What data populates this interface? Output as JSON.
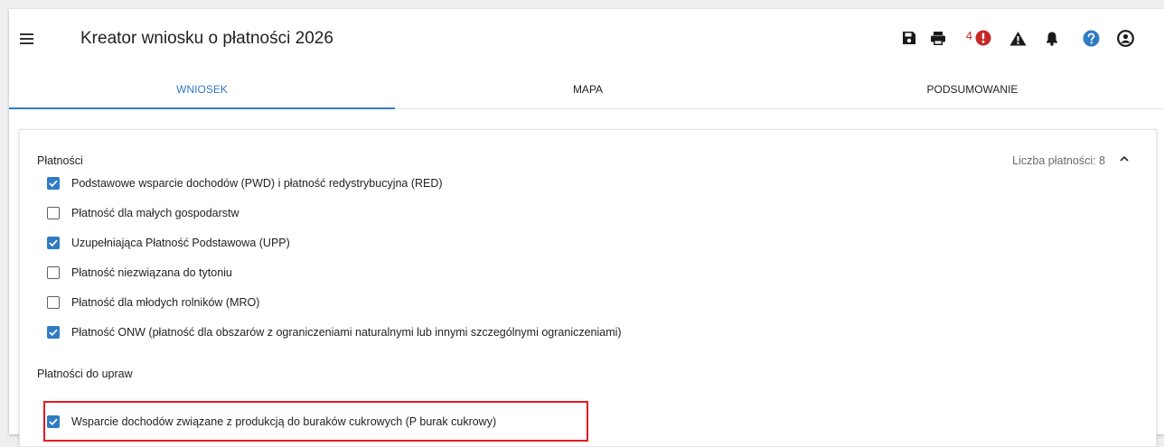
{
  "header": {
    "title": "Kreator wniosku o płatności 2026",
    "warning_count": "4"
  },
  "icons": {
    "menu": "menu-icon",
    "save": "save-icon",
    "print": "print-icon",
    "error": "error-icon",
    "warning": "warning-icon",
    "notifications": "bell-icon",
    "help": "help-icon",
    "account": "account-icon"
  },
  "colors": {
    "accent": "#2f7bc4",
    "error": "#c62828",
    "highlight": "#e31b23"
  },
  "tabs": [
    {
      "label": "WNIOSEK",
      "active": true
    },
    {
      "label": "MAPA",
      "active": false
    },
    {
      "label": "PODSUMOWANIE",
      "active": false
    }
  ],
  "payments": {
    "title": "Płatności",
    "count_label": "Liczba płatności: 8",
    "items": [
      {
        "label": "Podstawowe wsparcie dochodów (PWD) i płatność redystrybucyjna (RED)",
        "checked": true
      },
      {
        "label": "Płatność dla małych gospodarstw",
        "checked": false
      },
      {
        "label": "Uzupełniająca Płatność Podstawowa (UPP)",
        "checked": true
      },
      {
        "label": "Płatność niezwiązana do tytoniu",
        "checked": false
      },
      {
        "label": "Płatność dla młodych rolników (MRO)",
        "checked": false
      },
      {
        "label": "Płatność ONW (płatność dla obszarów z ograniczeniami naturalnymi lub innymi szczególnymi ograniczeniami)",
        "checked": true
      }
    ]
  },
  "crop_payments": {
    "title": "Płatności do upraw",
    "items": [
      {
        "label": "Wsparcie dochodów związane z produkcją do buraków cukrowych (P burak cukrowy)",
        "checked": true
      }
    ]
  }
}
